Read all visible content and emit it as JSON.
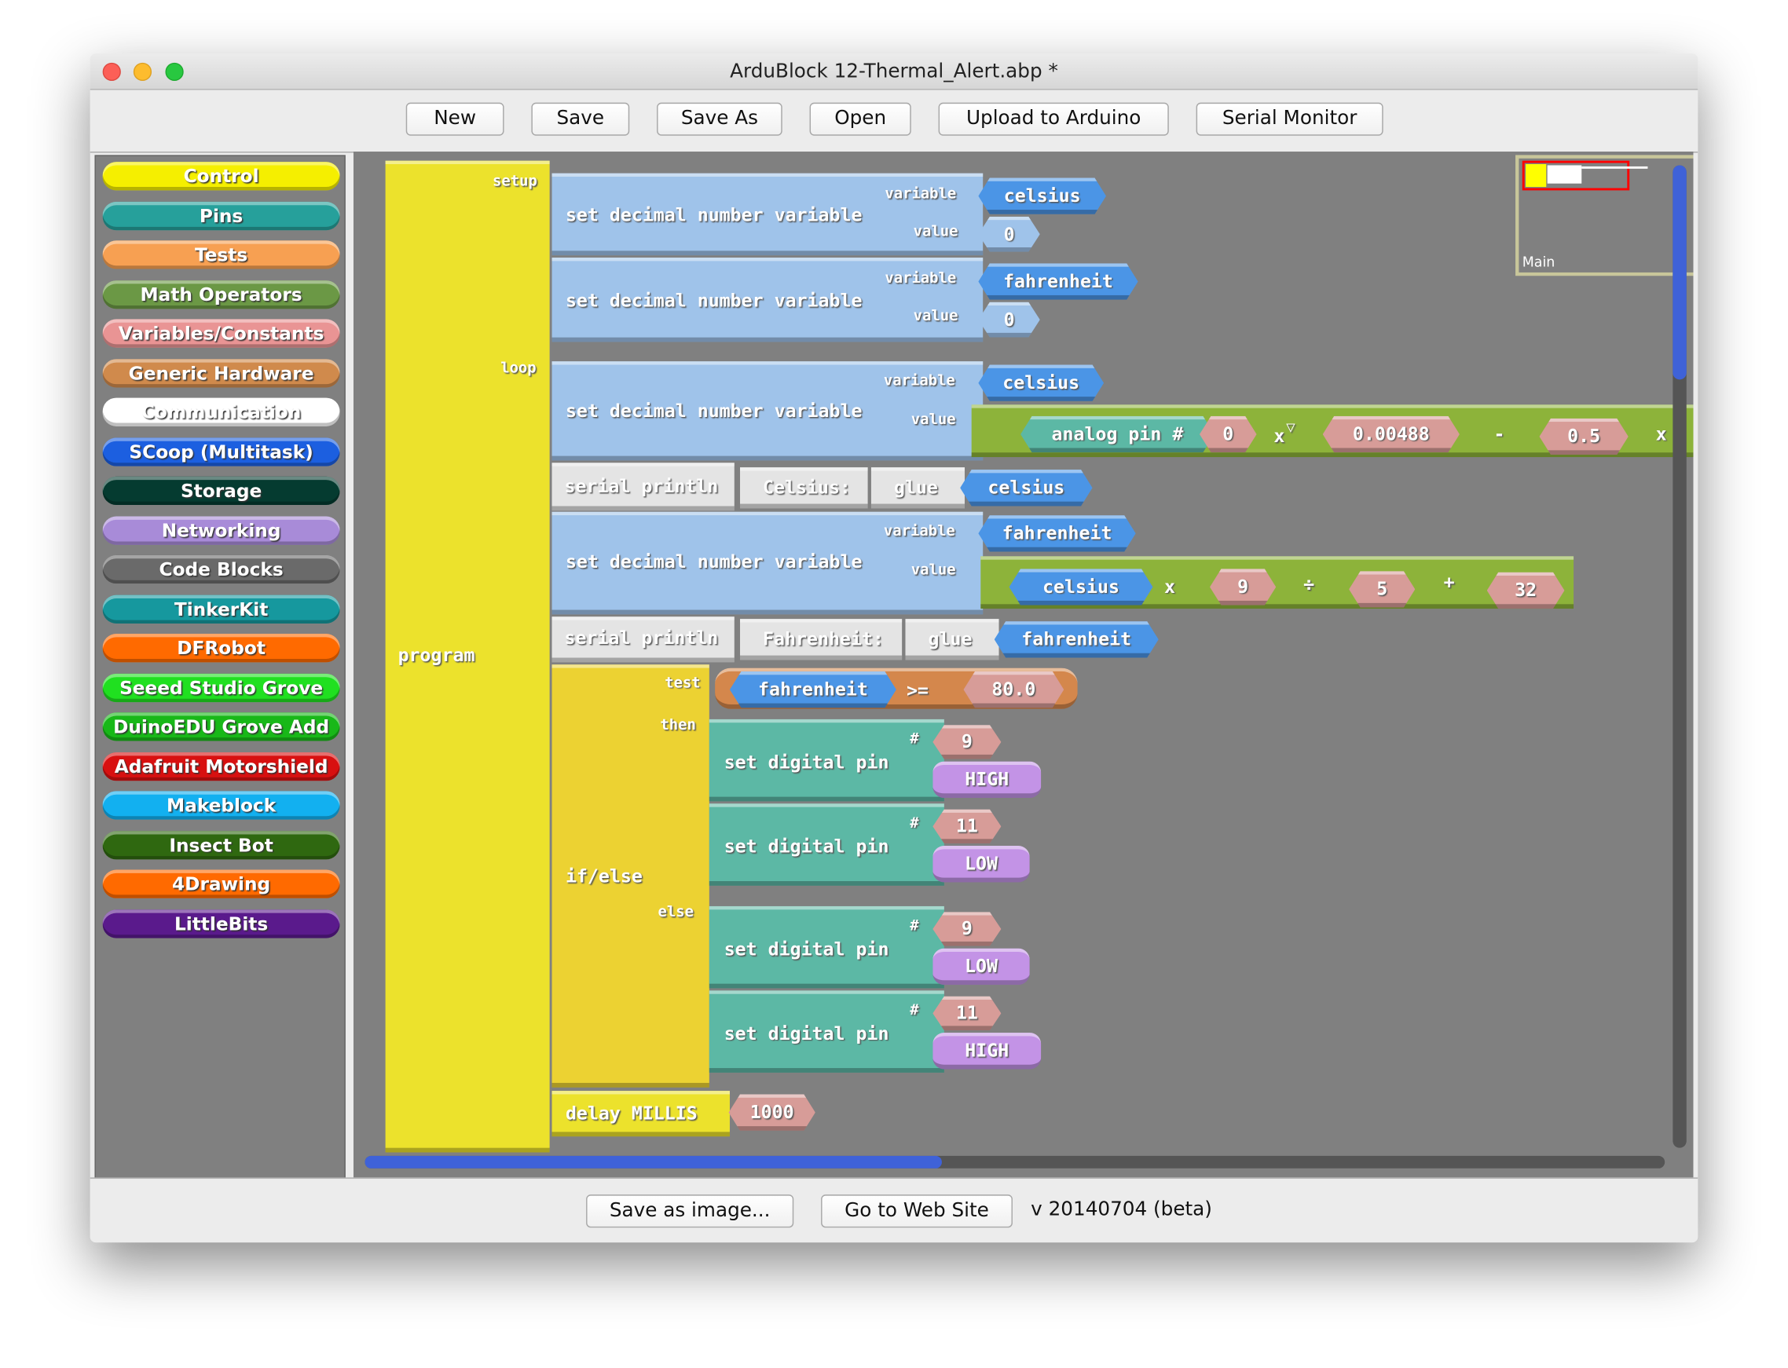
{
  "window": {
    "title": "ArduBlock 12-Thermal_Alert.abp *"
  },
  "toolbar": {
    "new": "New",
    "save": "Save",
    "save_as": "Save As",
    "open": "Open",
    "upload": "Upload to Arduino",
    "serial_monitor": "Serial Monitor"
  },
  "palette": [
    {
      "label": "Control",
      "color": "#f5ef00"
    },
    {
      "label": "Pins",
      "color": "#26a09b"
    },
    {
      "label": "Tests",
      "color": "#f7a052"
    },
    {
      "label": "Math Operators",
      "color": "#6b9845"
    },
    {
      "label": "Variables/Constants",
      "color": "#e99494"
    },
    {
      "label": "Generic Hardware",
      "color": "#d08a4c"
    },
    {
      "label": "Communication",
      "color": "#ffffff"
    },
    {
      "label": "SCoop (Multitask)",
      "color": "#1c5fe0"
    },
    {
      "label": "Storage",
      "color": "#053b30"
    },
    {
      "label": "Networking",
      "color": "#a88bd8"
    },
    {
      "label": "Code Blocks",
      "color": "#6a6a6a"
    },
    {
      "label": "TinkerKit",
      "color": "#16989e"
    },
    {
      "label": "DFRobot",
      "color": "#ff6a00"
    },
    {
      "label": "Seeed Studio Grove",
      "color": "#20e020"
    },
    {
      "label": "DuinoEDU Grove Add",
      "color": "#18b818"
    },
    {
      "label": "Adafruit Motorshield",
      "color": "#d81010"
    },
    {
      "label": "Makeblock",
      "color": "#12b0f0"
    },
    {
      "label": "Insect Bot",
      "color": "#2f6810"
    },
    {
      "label": "4Drawing",
      "color": "#ff6a00"
    },
    {
      "label": "LittleBits",
      "color": "#5a1a8c"
    }
  ],
  "minimap": {
    "label": "Main"
  },
  "program": {
    "label": "program",
    "setup": "setup",
    "loop": "loop",
    "set_label": "set decimal number variable",
    "variable": "variable",
    "value": "value",
    "setup_blocks": [
      {
        "var": "celsius",
        "val": "0"
      },
      {
        "var": "fahrenheit",
        "val": "0"
      }
    ],
    "loop_set1": {
      "var": "celsius",
      "analog": "analog pin",
      "hash": "#",
      "pin": "0",
      "times": "x",
      "factor": "0.00488",
      "minus": "-",
      "offset": "0.5",
      "times2": "x"
    },
    "println1": {
      "label": "serial println",
      "text": "Celsius:",
      "glue": "glue",
      "var": "celsius"
    },
    "loop_set2": {
      "var": "fahrenheit",
      "operand": "celsius",
      "times": "x",
      "a": "9",
      "div": "÷",
      "b": "5",
      "plus": "+",
      "c": "32"
    },
    "println2": {
      "label": "serial println",
      "text": "Fahrenheit:",
      "glue": "glue",
      "var": "fahrenheit"
    },
    "ifelse": {
      "label": "if/else",
      "test": "test",
      "then": "then",
      "else": "else",
      "var": "fahrenheit",
      "op": ">=",
      "threshold": "80.0"
    },
    "digital_label": "set digital pin",
    "then_blocks": [
      {
        "pin": "9",
        "state": "HIGH"
      },
      {
        "pin": "11",
        "state": "LOW"
      }
    ],
    "else_blocks": [
      {
        "pin": "9",
        "state": "LOW"
      },
      {
        "pin": "11",
        "state": "HIGH"
      }
    ],
    "delay": {
      "label": "delay MILLIS",
      "value": "1000"
    }
  },
  "bottom": {
    "save_image": "Save as image...",
    "website": "Go to Web Site",
    "version": "v 20140704 (beta)"
  }
}
